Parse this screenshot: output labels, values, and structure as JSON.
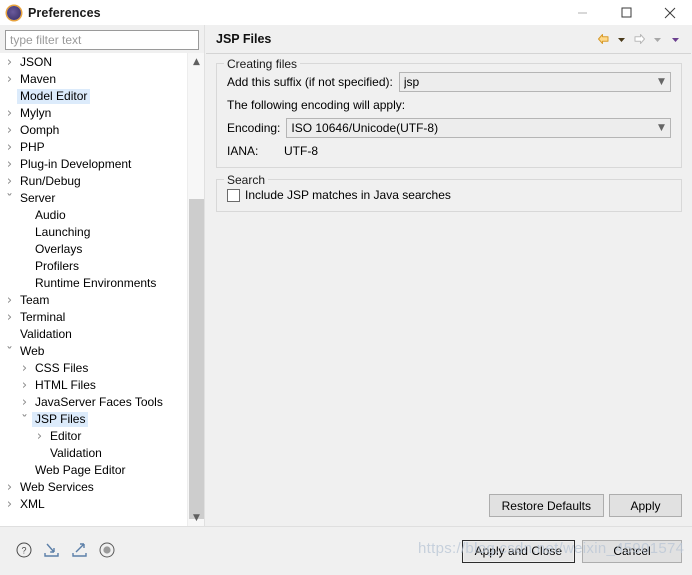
{
  "window": {
    "title": "Preferences",
    "icon": "eclipse-preferences-icon",
    "controls": {
      "minimize": "minimize-icon",
      "maximize": "maximize-icon",
      "close": "close-icon"
    }
  },
  "filter": {
    "placeholder": "type filter text",
    "value": ""
  },
  "tree": {
    "items": [
      {
        "label": "JSON",
        "indent": 0,
        "twisty": "collapsed",
        "selected": false
      },
      {
        "label": "Maven",
        "indent": 0,
        "twisty": "collapsed",
        "selected": false
      },
      {
        "label": "Model Editor",
        "indent": 0,
        "twisty": "none",
        "selected": true
      },
      {
        "label": "Mylyn",
        "indent": 0,
        "twisty": "collapsed",
        "selected": false
      },
      {
        "label": "Oomph",
        "indent": 0,
        "twisty": "collapsed",
        "selected": false
      },
      {
        "label": "PHP",
        "indent": 0,
        "twisty": "collapsed",
        "selected": false
      },
      {
        "label": "Plug-in Development",
        "indent": 0,
        "twisty": "collapsed",
        "selected": false
      },
      {
        "label": "Run/Debug",
        "indent": 0,
        "twisty": "collapsed",
        "selected": false
      },
      {
        "label": "Server",
        "indent": 0,
        "twisty": "expanded",
        "selected": false
      },
      {
        "label": "Audio",
        "indent": 1,
        "twisty": "none",
        "selected": false
      },
      {
        "label": "Launching",
        "indent": 1,
        "twisty": "none",
        "selected": false
      },
      {
        "label": "Overlays",
        "indent": 1,
        "twisty": "none",
        "selected": false
      },
      {
        "label": "Profilers",
        "indent": 1,
        "twisty": "none",
        "selected": false
      },
      {
        "label": "Runtime Environments",
        "indent": 1,
        "twisty": "none",
        "selected": false
      },
      {
        "label": "Team",
        "indent": 0,
        "twisty": "collapsed",
        "selected": false
      },
      {
        "label": "Terminal",
        "indent": 0,
        "twisty": "collapsed",
        "selected": false
      },
      {
        "label": "Validation",
        "indent": 0,
        "twisty": "none",
        "selected": false
      },
      {
        "label": "Web",
        "indent": 0,
        "twisty": "expanded",
        "selected": false
      },
      {
        "label": "CSS Files",
        "indent": 1,
        "twisty": "collapsed",
        "selected": false
      },
      {
        "label": "HTML Files",
        "indent": 1,
        "twisty": "collapsed",
        "selected": false
      },
      {
        "label": "JavaServer Faces Tools",
        "indent": 1,
        "twisty": "collapsed",
        "selected": false
      },
      {
        "label": "JSP Files",
        "indent": 1,
        "twisty": "expanded",
        "selected": true
      },
      {
        "label": "Editor",
        "indent": 2,
        "twisty": "collapsed",
        "selected": false
      },
      {
        "label": "Validation",
        "indent": 2,
        "twisty": "none",
        "selected": false
      },
      {
        "label": "Web Page Editor",
        "indent": 1,
        "twisty": "none",
        "selected": false
      },
      {
        "label": "Web Services",
        "indent": 0,
        "twisty": "collapsed",
        "selected": false
      },
      {
        "label": "XML",
        "indent": 0,
        "twisty": "collapsed",
        "selected": false
      }
    ],
    "scrollbar": {
      "up_arrow": "chevron-up-icon",
      "down_arrow": "chevron-down-icon"
    }
  },
  "page": {
    "title": "JSP Files",
    "nav": {
      "back": "back-arrow-icon",
      "back_menu": "dropdown-arrow-icon",
      "forward": "forward-arrow-icon",
      "forward_menu": "dropdown-arrow-icon",
      "view_menu": "view-menu-arrow-icon"
    },
    "creating_files": {
      "title": "Creating files",
      "suffix_label": "Add this suffix (if not specified):",
      "suffix_value": "jsp",
      "encoding_intro": "The following encoding will apply:",
      "encoding_label": "Encoding:",
      "encoding_value": "ISO 10646/Unicode(UTF-8)",
      "iana_label": "IANA:",
      "iana_value": "UTF-8"
    },
    "search": {
      "title": "Search",
      "include_jsp_label": "Include JSP matches in Java searches",
      "include_jsp_checked": false
    },
    "buttons": {
      "restore_defaults": "Restore Defaults",
      "apply": "Apply"
    }
  },
  "bottom": {
    "icons": {
      "help": "help-icon",
      "import": "import-icon",
      "export": "export-icon",
      "record": "record-icon"
    },
    "apply_and_close": "Apply and Close",
    "cancel": "Cancel"
  },
  "watermark": "https://blog.csdn.net/weixin_45901574"
}
